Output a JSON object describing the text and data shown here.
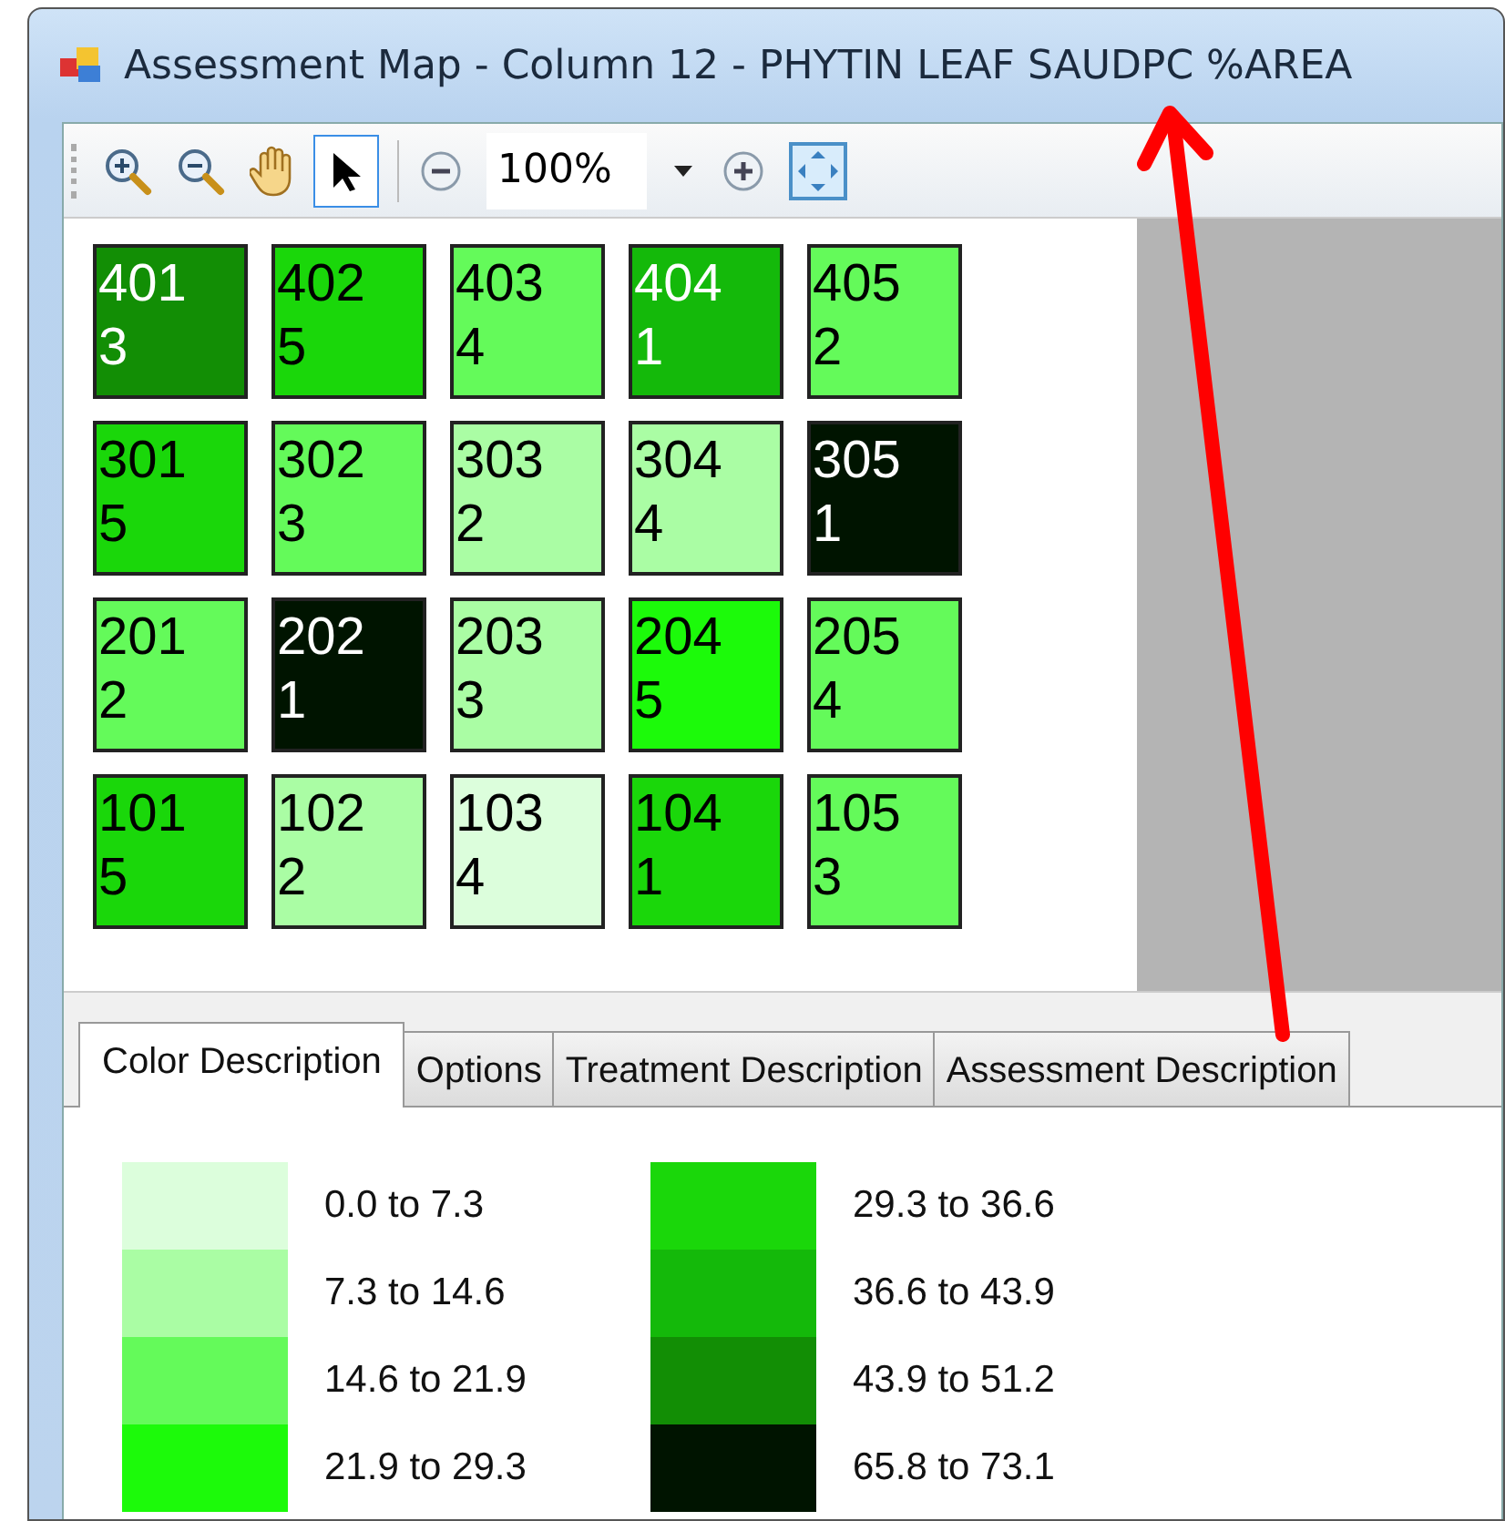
{
  "window": {
    "title": "Assessment Map - Column 12 - PHYTIN LEAF SAUDPC %AREA"
  },
  "toolbar": {
    "tools": [
      {
        "kind": "zoom-in",
        "selected": false
      },
      {
        "kind": "zoom-out",
        "selected": false
      },
      {
        "kind": "pan",
        "selected": false
      },
      {
        "kind": "pointer",
        "selected": true
      }
    ],
    "zoom": {
      "value": "100%"
    }
  },
  "plots": [
    [
      {
        "id": "401",
        "value": "3",
        "color": "#128e05"
      },
      {
        "id": "402",
        "value": "5",
        "color": "#1ad70a"
      },
      {
        "id": "403",
        "value": "4",
        "color": "#64fa5a"
      },
      {
        "id": "404",
        "value": "1",
        "color": "#14b90a"
      },
      {
        "id": "405",
        "value": "2",
        "color": "#64fa5a"
      }
    ],
    [
      {
        "id": "301",
        "value": "5",
        "color": "#1ad70a"
      },
      {
        "id": "302",
        "value": "3",
        "color": "#64fa5a"
      },
      {
        "id": "303",
        "value": "2",
        "color": "#aafda4"
      },
      {
        "id": "304",
        "value": "4",
        "color": "#aafda4"
      },
      {
        "id": "305",
        "value": "1",
        "color": "#001400"
      }
    ],
    [
      {
        "id": "201",
        "value": "2",
        "color": "#64fa5a"
      },
      {
        "id": "202",
        "value": "1",
        "color": "#001400"
      },
      {
        "id": "203",
        "value": "3",
        "color": "#aafda4"
      },
      {
        "id": "204",
        "value": "5",
        "color": "#1cfa0a"
      },
      {
        "id": "205",
        "value": "4",
        "color": "#64fa5a"
      }
    ],
    [
      {
        "id": "101",
        "value": "5",
        "color": "#1ad70a"
      },
      {
        "id": "102",
        "value": "2",
        "color": "#aafda4"
      },
      {
        "id": "103",
        "value": "4",
        "color": "#dcfedc"
      },
      {
        "id": "104",
        "value": "1",
        "color": "#1ad70a"
      },
      {
        "id": "105",
        "value": "3",
        "color": "#64fa5a"
      }
    ]
  ],
  "tabs": [
    {
      "label": "Color Description",
      "selected": true
    },
    {
      "label": "Options",
      "selected": false
    },
    {
      "label": "Treatment Description",
      "selected": false
    },
    {
      "label": "Assessment Description",
      "selected": false
    }
  ],
  "legend": [
    {
      "label": "0.0 to 7.3",
      "color": "#dcfedc"
    },
    {
      "label": "7.3 to 14.6",
      "color": "#aafda4"
    },
    {
      "label": "14.6 to 21.9",
      "color": "#64fa5a"
    },
    {
      "label": "21.9 to 29.3",
      "color": "#1cfa0a"
    },
    {
      "label": "29.3 to 36.6",
      "color": "#1ad70a"
    },
    {
      "label": "36.6 to 43.9",
      "color": "#14b90a"
    },
    {
      "label": "43.9 to 51.2",
      "color": "#128e05"
    },
    {
      "label": "65.8 to 73.1",
      "color": "#001400"
    }
  ]
}
